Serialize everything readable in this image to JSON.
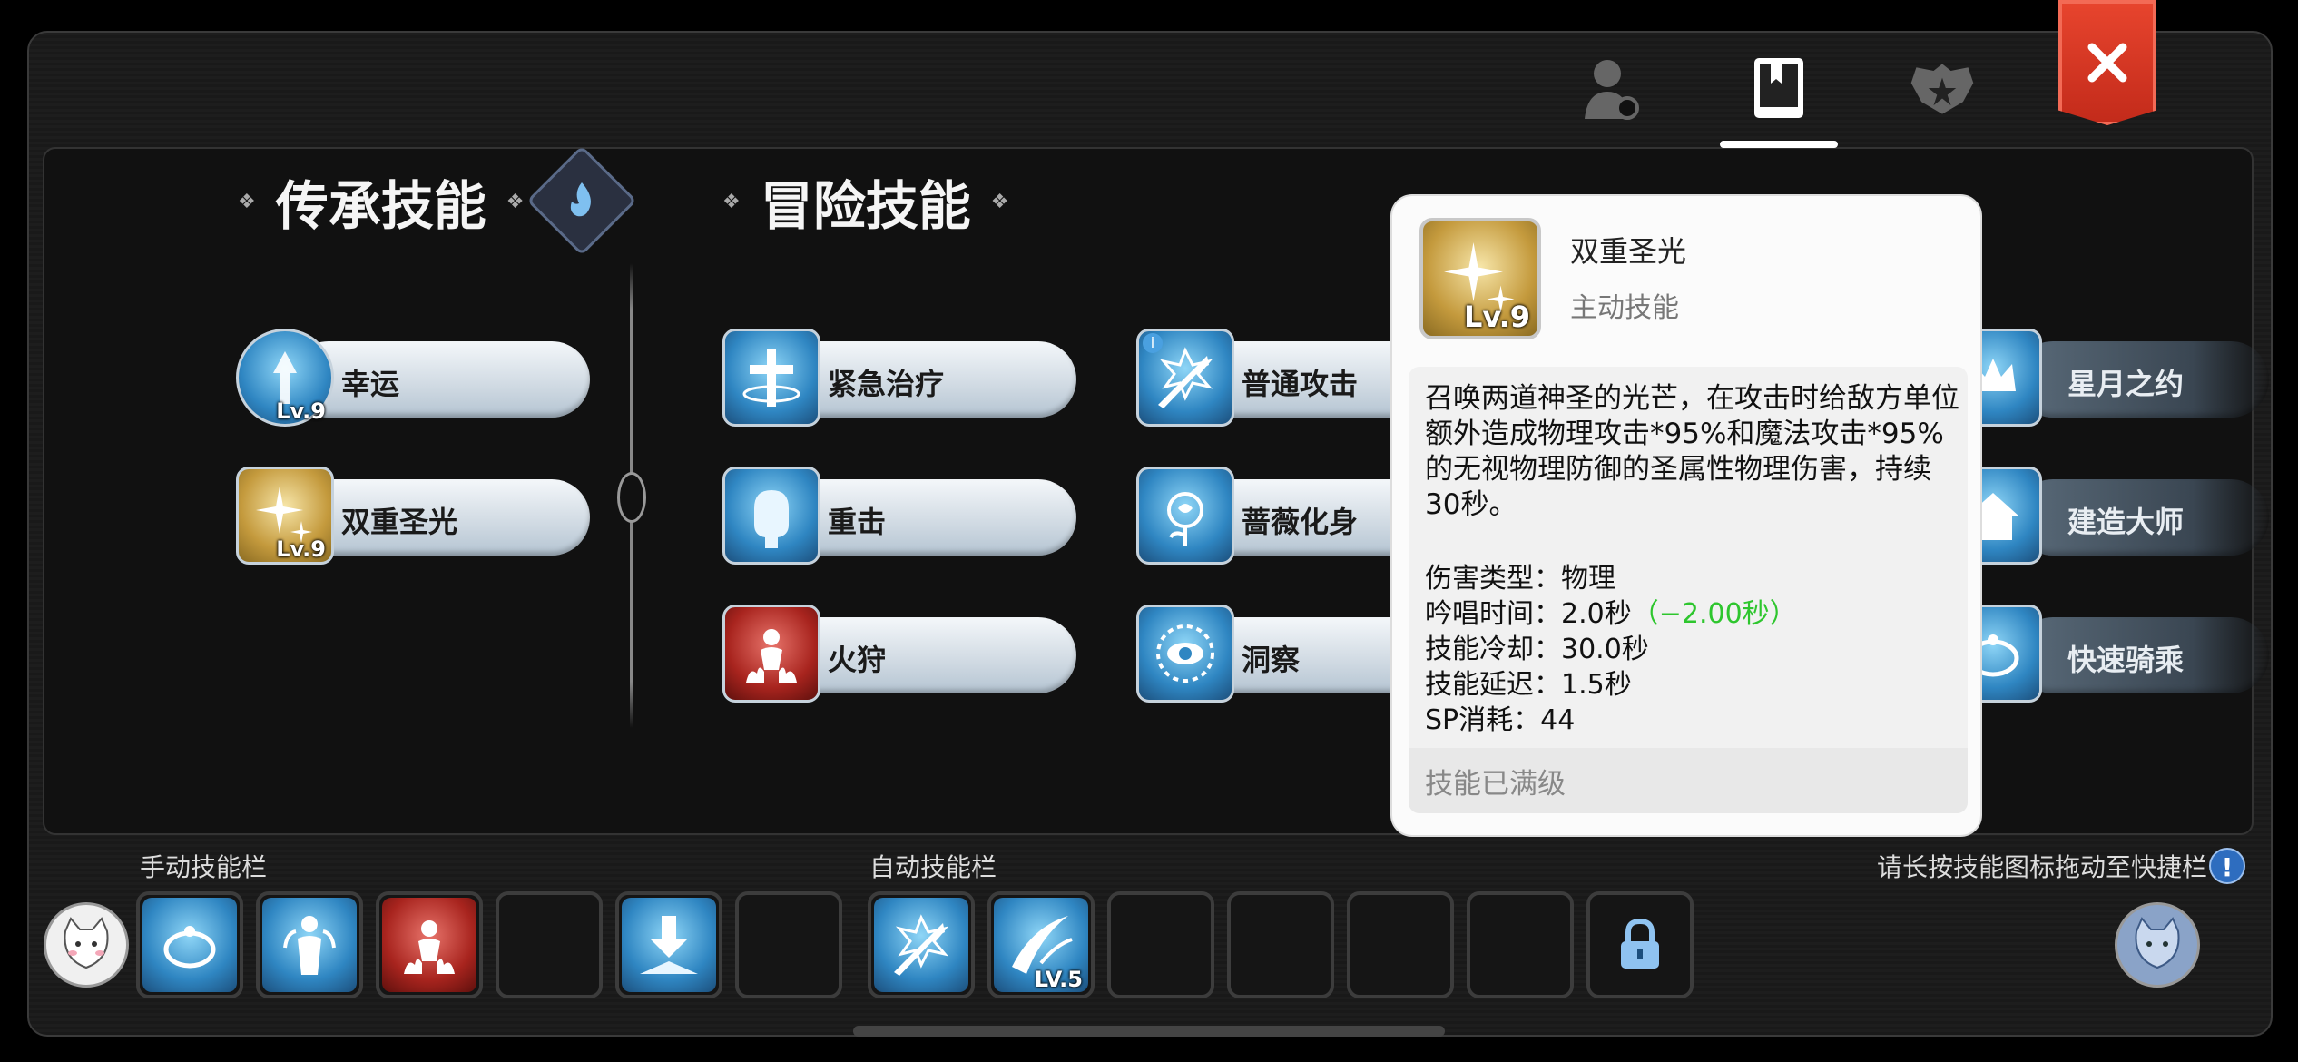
{
  "heading": {
    "inherit": "传承技能",
    "adventure": "冒险技能"
  },
  "inherit_skills": [
    {
      "label": "幸运",
      "lv": "Lv.9"
    },
    {
      "label": "双重圣光",
      "lv": "Lv.9"
    }
  ],
  "adventure_skills": [
    {
      "label": "紧急治疗"
    },
    {
      "label": "重击"
    },
    {
      "label": "火狩"
    },
    {
      "label": "普通攻击"
    },
    {
      "label": "蔷薇化身"
    },
    {
      "label": "洞察"
    },
    {
      "label": "星月之约"
    },
    {
      "label": "建造大师"
    },
    {
      "label": "快速骑乘"
    }
  ],
  "tooltip": {
    "name": "双重圣光",
    "type": "主动技能",
    "lv": "Lv.9",
    "description": "召唤两道神圣的光芒，在攻击时给敌方单位额外造成物理攻击*95%和魔法攻击*95%的无视物理防御的圣属性物理伤害，持续30秒。",
    "damage_type": "伤害类型：物理",
    "cast_time": "吟唱时间：2.0秒",
    "cast_time_bonus": "（−2.00秒）",
    "cooldown": "技能冷却：30.0秒",
    "delay": "技能延迟：1.5秒",
    "sp": "SP消耗：44",
    "max_level": "技能已满级"
  },
  "bottom": {
    "manual_label": "手动技能栏",
    "auto_label": "自动技能栏",
    "hint": "请长按技能图标拖动至快捷栏",
    "hint_icon": "!",
    "auto_slot_lv": "LV.5"
  },
  "colors": {
    "accent_red": "#d8351f",
    "bonus_green": "#2ec62e"
  }
}
